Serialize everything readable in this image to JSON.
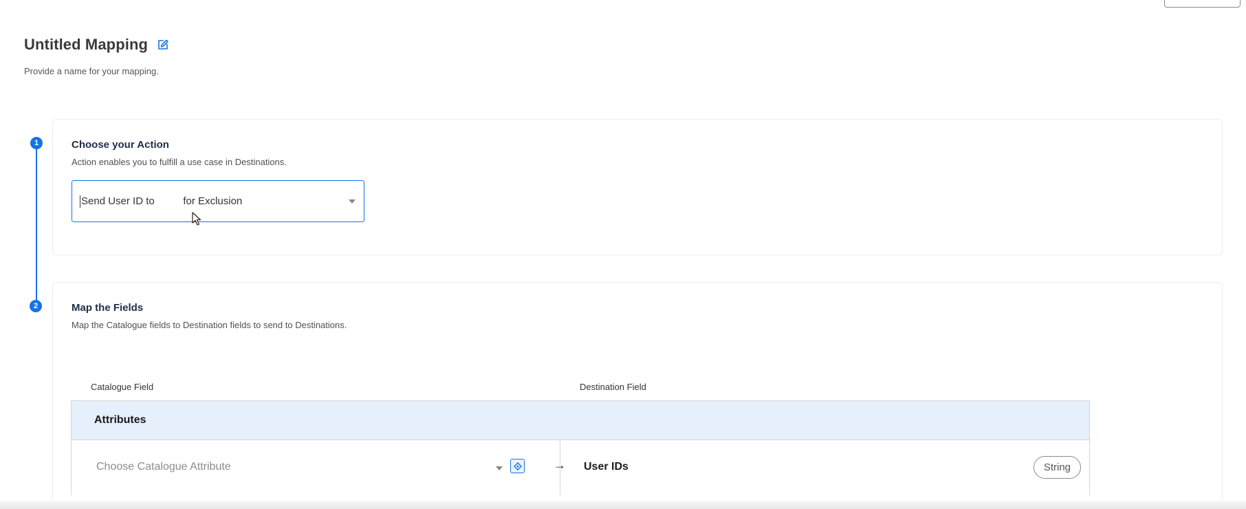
{
  "header": {
    "title": "Untitled Mapping",
    "subtitle": "Provide a name for your mapping."
  },
  "steps": [
    {
      "number": "1",
      "title": "Choose your Action",
      "description": "Action enables you to fulfill a use case in Destinations.",
      "select_value": "Send User ID to          for Exclusion"
    },
    {
      "number": "2",
      "title": "Map the Fields",
      "description": "Map the Catalogue fields to Destination fields to send to Destinations."
    }
  ],
  "mapping": {
    "columns": {
      "source": "Catalogue Field",
      "destination": "Destination Field"
    },
    "group_label": "Attributes",
    "rows": [
      {
        "source_placeholder": "Choose Catalogue Attribute",
        "arrow": "→",
        "destination": "User IDs",
        "type": "String"
      }
    ]
  },
  "colors": {
    "accent": "#1473e6",
    "group_row_bg": "#e6effc"
  },
  "icons": {
    "edit": "edit-icon",
    "dropdown": "chevron-down-icon",
    "attribute_picker": "attribute-picker-icon",
    "map_arrow": "arrow-right-icon"
  }
}
